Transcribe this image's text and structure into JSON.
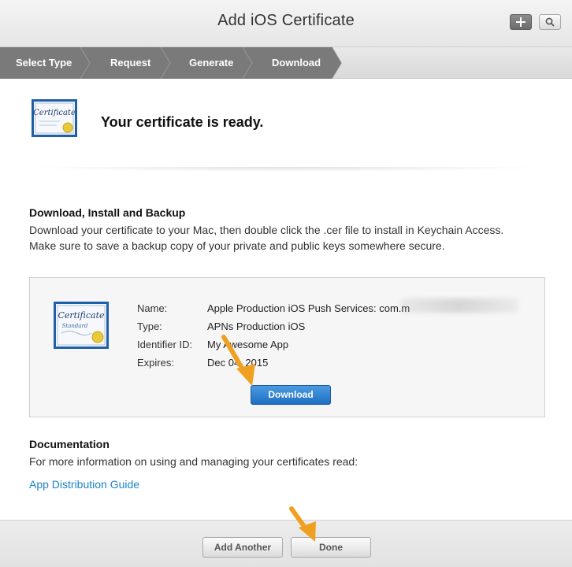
{
  "header": {
    "title": "Add iOS Certificate",
    "add_icon": "plus-icon",
    "search_icon": "search-icon"
  },
  "steps": [
    "Select Type",
    "Request",
    "Generate",
    "Download"
  ],
  "ready": {
    "title": "Your certificate is ready.",
    "icon_text": "Certificate"
  },
  "install": {
    "title": "Download, Install and Backup",
    "text": "Download your certificate to your Mac, then double click the .cer file to install in Keychain Access. Make sure to save a backup copy of your private and public keys somewhere secure."
  },
  "certificate": {
    "icon_text": "Certificate",
    "icon_subtext": "Standard",
    "fields": [
      {
        "label": "Name:",
        "value": "Apple Production iOS Push Services: com.m"
      },
      {
        "label": "Type:",
        "value": "APNs Production iOS"
      },
      {
        "label": "Identifier ID:",
        "value": "My Awesome App"
      },
      {
        "label": "Expires:",
        "value": "Dec 04, 2015"
      }
    ],
    "download_label": "Download"
  },
  "documentation": {
    "title": "Documentation",
    "text": "For more information on using and managing your certificates read:",
    "link": "App Distribution Guide"
  },
  "footer": {
    "add_another_label": "Add Another",
    "done_label": "Done"
  },
  "colors": {
    "accent_blue": "#1f6fc3",
    "link_blue": "#1a84c7",
    "annotation_arrow": "#f0a020",
    "step_active": "#777777"
  }
}
